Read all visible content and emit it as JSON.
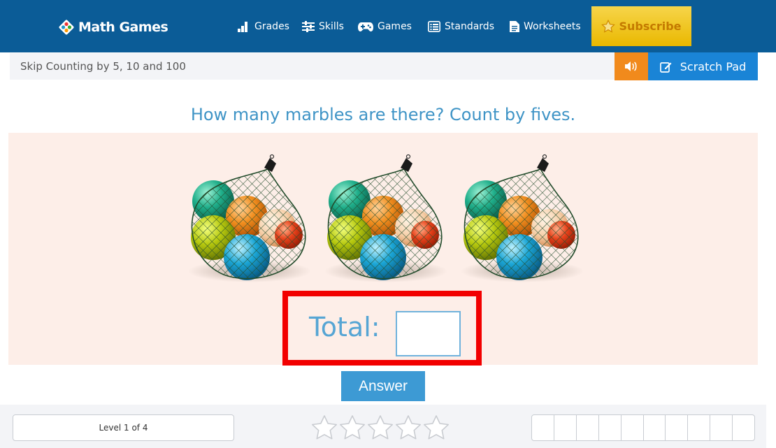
{
  "header": {
    "logo_text": "Math Games",
    "nav": [
      {
        "label": "Grades",
        "icon": "bar-chart-icon"
      },
      {
        "label": "Skills",
        "icon": "sliders-icon"
      },
      {
        "label": "Games",
        "icon": "gamepad-icon"
      },
      {
        "label": "Standards",
        "icon": "list-icon"
      },
      {
        "label": "Worksheets",
        "icon": "document-icon"
      }
    ],
    "subscribe_label": "Subscribe",
    "colors": {
      "bar": "#0b5c97",
      "subscribe": "#f2c21b"
    }
  },
  "breadcrumb": {
    "title": "Skip Counting by 5, 10 and 100",
    "sound_icon": "speaker-icon",
    "scratch_pad_label": "Scratch Pad"
  },
  "question": {
    "text": "How many marbles are there? Count by fives.",
    "bags_count": 3,
    "total_label": "Total:",
    "total_value": "",
    "answer_label": "Answer"
  },
  "footer": {
    "level_text": "Level 1 of 4",
    "stars_total": 5,
    "stars_filled": 0,
    "progress_cells": 10,
    "progress_filled": 0
  }
}
